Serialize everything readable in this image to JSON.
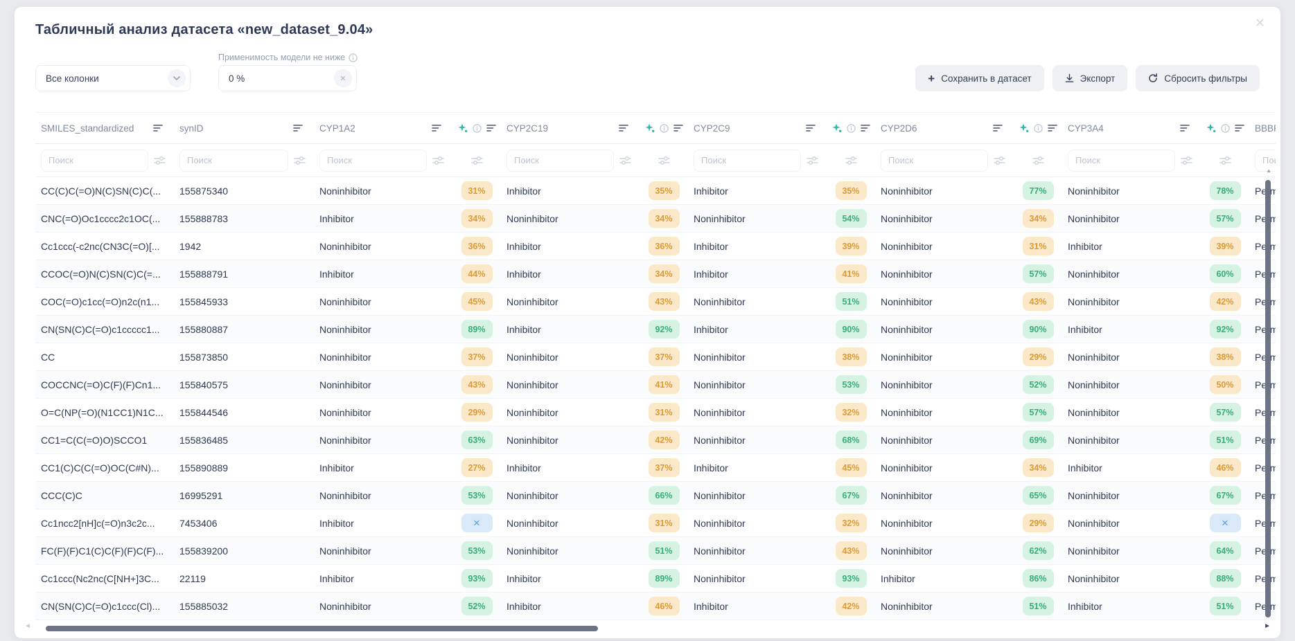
{
  "page": {
    "title": "Табличный анализ датасета «new_dataset_9.04»"
  },
  "controls": {
    "columns_select": "Все колонки",
    "applicability_label": "Применимость модели не ниже",
    "applicability_value": "0 %",
    "save_button": "Сохранить в датасет",
    "export_button": "Экспорт",
    "reset_button": "Сбросить фильтры"
  },
  "colors": {
    "badge_orange_bg": "#fbe8c9",
    "badge_orange_text": "#dd9a32",
    "badge_green_bg": "#d6f2e2",
    "badge_green_text": "#35ae77",
    "badge_na_bg": "#d9e9f8",
    "badge_na_text": "#5f9fdd",
    "sparkle_accent": "#2eb8a5"
  },
  "table": {
    "search_placeholder": "Поиск",
    "columns": [
      {
        "id": "smiles",
        "label": "SMILES_standardized",
        "type": "text"
      },
      {
        "id": "synid",
        "label": "synID",
        "type": "text"
      },
      {
        "id": "cyp1a2",
        "label": "CYP1A2",
        "type": "model"
      },
      {
        "id": "cyp2c19",
        "label": "CYP2C19",
        "type": "model"
      },
      {
        "id": "cyp2c9",
        "label": "CYP2C9",
        "type": "model"
      },
      {
        "id": "cyp2d6",
        "label": "CYP2D6",
        "type": "model"
      },
      {
        "id": "cyp3a4",
        "label": "CYP3A4",
        "type": "model"
      },
      {
        "id": "bbbp",
        "label": "BBBP",
        "type": "model"
      }
    ],
    "rows": [
      {
        "smiles": "CC(C)C(=O)N(C)SN(C)C(...",
        "synid": "155875340",
        "cyp1a2": {
          "v": "Noninhibitor",
          "p": 31
        },
        "cyp2c19": {
          "v": "Inhibitor",
          "p": 35
        },
        "cyp2c9": {
          "v": "Inhibitor",
          "p": 35
        },
        "cyp2d6": {
          "v": "Noninhibitor",
          "p": 77
        },
        "cyp3a4": {
          "v": "Noninhibitor",
          "p": 78
        },
        "bbbp": {
          "v": "Permeable"
        }
      },
      {
        "smiles": "CNC(=O)Oc1cccc2c1OC(...",
        "synid": "155888783",
        "cyp1a2": {
          "v": "Inhibitor",
          "p": 34
        },
        "cyp2c19": {
          "v": "Noninhibitor",
          "p": 34
        },
        "cyp2c9": {
          "v": "Noninhibitor",
          "p": 54
        },
        "cyp2d6": {
          "v": "Noninhibitor",
          "p": 34
        },
        "cyp3a4": {
          "v": "Noninhibitor",
          "p": 57
        },
        "bbbp": {
          "v": "Permeable"
        }
      },
      {
        "smiles": "Cc1ccc(-c2nc(CN3C(=O)[...",
        "synid": "1942",
        "cyp1a2": {
          "v": "Noninhibitor",
          "p": 36
        },
        "cyp2c19": {
          "v": "Inhibitor",
          "p": 36
        },
        "cyp2c9": {
          "v": "Inhibitor",
          "p": 39
        },
        "cyp2d6": {
          "v": "Noninhibitor",
          "p": 31
        },
        "cyp3a4": {
          "v": "Inhibitor",
          "p": 39
        },
        "bbbp": {
          "v": "Permeable"
        }
      },
      {
        "smiles": "CCOC(=O)N(C)SN(C)C(=...",
        "synid": "155888791",
        "cyp1a2": {
          "v": "Inhibitor",
          "p": 44
        },
        "cyp2c19": {
          "v": "Inhibitor",
          "p": 34
        },
        "cyp2c9": {
          "v": "Inhibitor",
          "p": 41
        },
        "cyp2d6": {
          "v": "Noninhibitor",
          "p": 57
        },
        "cyp3a4": {
          "v": "Noninhibitor",
          "p": 60
        },
        "bbbp": {
          "v": "Permeable"
        }
      },
      {
        "smiles": "COC(=O)c1cc(=O)n2c(n1...",
        "synid": "155845933",
        "cyp1a2": {
          "v": "Noninhibitor",
          "p": 45
        },
        "cyp2c19": {
          "v": "Noninhibitor",
          "p": 43
        },
        "cyp2c9": {
          "v": "Noninhibitor",
          "p": 51
        },
        "cyp2d6": {
          "v": "Noninhibitor",
          "p": 43
        },
        "cyp3a4": {
          "v": "Noninhibitor",
          "p": 42
        },
        "bbbp": {
          "v": "Permeable"
        }
      },
      {
        "smiles": "CN(SN(C)C(=O)c1ccccc1...",
        "synid": "155880887",
        "cyp1a2": {
          "v": "Noninhibitor",
          "p": 89
        },
        "cyp2c19": {
          "v": "Inhibitor",
          "p": 92
        },
        "cyp2c9": {
          "v": "Inhibitor",
          "p": 90
        },
        "cyp2d6": {
          "v": "Noninhibitor",
          "p": 90
        },
        "cyp3a4": {
          "v": "Inhibitor",
          "p": 92
        },
        "bbbp": {
          "v": "Permeable"
        }
      },
      {
        "smiles": "CC",
        "synid": "155873850",
        "cyp1a2": {
          "v": "Noninhibitor",
          "p": 37
        },
        "cyp2c19": {
          "v": "Noninhibitor",
          "p": 37
        },
        "cyp2c9": {
          "v": "Noninhibitor",
          "p": 38
        },
        "cyp2d6": {
          "v": "Noninhibitor",
          "p": 29
        },
        "cyp3a4": {
          "v": "Noninhibitor",
          "p": 38
        },
        "bbbp": {
          "v": "Permeable"
        }
      },
      {
        "smiles": "COCCNC(=O)C(F)(F)Cn1...",
        "synid": "155840575",
        "cyp1a2": {
          "v": "Noninhibitor",
          "p": 43
        },
        "cyp2c19": {
          "v": "Noninhibitor",
          "p": 41
        },
        "cyp2c9": {
          "v": "Noninhibitor",
          "p": 53
        },
        "cyp2d6": {
          "v": "Noninhibitor",
          "p": 52
        },
        "cyp3a4": {
          "v": "Noninhibitor",
          "p": 50
        },
        "bbbp": {
          "v": "Permeable"
        }
      },
      {
        "smiles": "O=C(NP(=O)(N1CC1)N1C...",
        "synid": "155844546",
        "cyp1a2": {
          "v": "Noninhibitor",
          "p": 29
        },
        "cyp2c19": {
          "v": "Noninhibitor",
          "p": 31
        },
        "cyp2c9": {
          "v": "Noninhibitor",
          "p": 32
        },
        "cyp2d6": {
          "v": "Noninhibitor",
          "p": 57
        },
        "cyp3a4": {
          "v": "Noninhibitor",
          "p": 57
        },
        "bbbp": {
          "v": "Permeable"
        }
      },
      {
        "smiles": "CC1=C(C(=O)O)SCCO1",
        "synid": "155836485",
        "cyp1a2": {
          "v": "Noninhibitor",
          "p": 63
        },
        "cyp2c19": {
          "v": "Noninhibitor",
          "p": 42
        },
        "cyp2c9": {
          "v": "Noninhibitor",
          "p": 68
        },
        "cyp2d6": {
          "v": "Noninhibitor",
          "p": 69
        },
        "cyp3a4": {
          "v": "Noninhibitor",
          "p": 51
        },
        "bbbp": {
          "v": "Permeable"
        }
      },
      {
        "smiles": "CC1(C)C(C(=O)OC(C#N)...",
        "synid": "155890889",
        "cyp1a2": {
          "v": "Inhibitor",
          "p": 27
        },
        "cyp2c19": {
          "v": "Inhibitor",
          "p": 37
        },
        "cyp2c9": {
          "v": "Inhibitor",
          "p": 45
        },
        "cyp2d6": {
          "v": "Noninhibitor",
          "p": 34
        },
        "cyp3a4": {
          "v": "Inhibitor",
          "p": 46
        },
        "bbbp": {
          "v": "Permeable"
        }
      },
      {
        "smiles": "CCC(C)C",
        "synid": "16995291",
        "cyp1a2": {
          "v": "Noninhibitor",
          "p": 53
        },
        "cyp2c19": {
          "v": "Noninhibitor",
          "p": 66
        },
        "cyp2c9": {
          "v": "Noninhibitor",
          "p": 67
        },
        "cyp2d6": {
          "v": "Noninhibitor",
          "p": 65
        },
        "cyp3a4": {
          "v": "Noninhibitor",
          "p": 67
        },
        "bbbp": {
          "v": "Permeable"
        }
      },
      {
        "smiles": "Cc1ncc2[nH]c(=O)n3c2c...",
        "synid": "7453406",
        "cyp1a2": {
          "v": "Inhibitor",
          "p": "x"
        },
        "cyp2c19": {
          "v": "Noninhibitor",
          "p": 31
        },
        "cyp2c9": {
          "v": "Noninhibitor",
          "p": 32
        },
        "cyp2d6": {
          "v": "Noninhibitor",
          "p": 29
        },
        "cyp3a4": {
          "v": "Noninhibitor",
          "p": "x"
        },
        "bbbp": {
          "v": "Permeable"
        }
      },
      {
        "smiles": "FC(F)(F)C1(C)C(F)(F)C(F)...",
        "synid": "155839200",
        "cyp1a2": {
          "v": "Noninhibitor",
          "p": 53
        },
        "cyp2c19": {
          "v": "Noninhibitor",
          "p": 51
        },
        "cyp2c9": {
          "v": "Noninhibitor",
          "p": 43
        },
        "cyp2d6": {
          "v": "Noninhibitor",
          "p": 62
        },
        "cyp3a4": {
          "v": "Noninhibitor",
          "p": 64
        },
        "bbbp": {
          "v": "Permeable"
        }
      },
      {
        "smiles": "Cc1ccc(Nc2nc(C[NH+]3C...",
        "synid": "22119",
        "cyp1a2": {
          "v": "Inhibitor",
          "p": 93
        },
        "cyp2c19": {
          "v": "Inhibitor",
          "p": 89
        },
        "cyp2c9": {
          "v": "Noninhibitor",
          "p": 93
        },
        "cyp2d6": {
          "v": "Inhibitor",
          "p": 86
        },
        "cyp3a4": {
          "v": "Noninhibitor",
          "p": 88
        },
        "bbbp": {
          "v": "Permeable"
        }
      },
      {
        "smiles": "CN(SN(C)C(=O)c1ccc(Cl)...",
        "synid": "155885032",
        "cyp1a2": {
          "v": "Noninhibitor",
          "p": 52
        },
        "cyp2c19": {
          "v": "Inhibitor",
          "p": 46
        },
        "cyp2c9": {
          "v": "Inhibitor",
          "p": 42
        },
        "cyp2d6": {
          "v": "Noninhibitor",
          "p": 51
        },
        "cyp3a4": {
          "v": "Inhibitor",
          "p": 51
        },
        "bbbp": {
          "v": "Permeable"
        }
      }
    ]
  }
}
